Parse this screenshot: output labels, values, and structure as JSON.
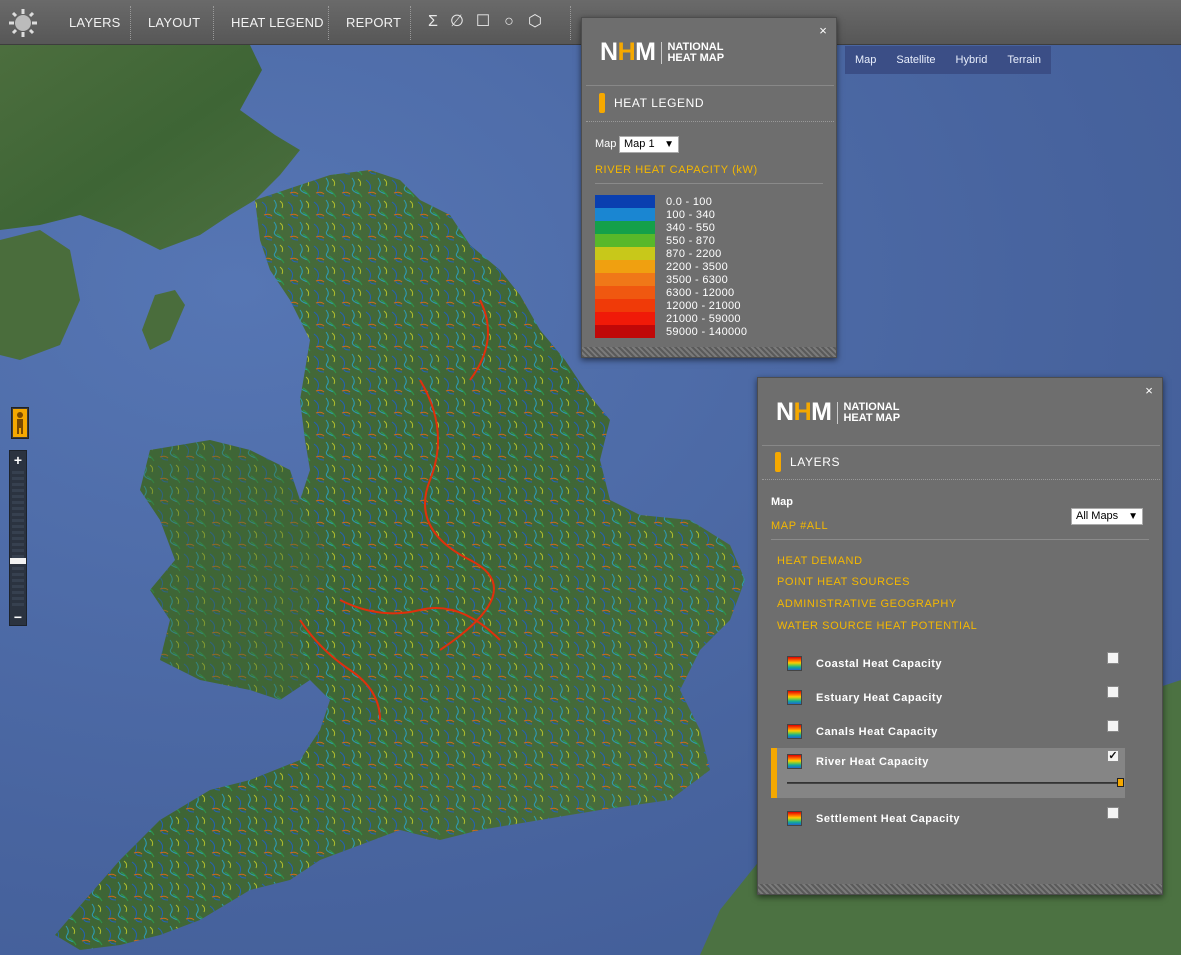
{
  "toolbar": {
    "items": [
      "LAYERS",
      "LAYOUT",
      "HEAT LEGEND",
      "REPORT"
    ],
    "tools": {
      "sum": "Σ",
      "clear": "∅",
      "rectangle": "☐",
      "circle": "○",
      "polygon": "⬡"
    }
  },
  "map_types": [
    "Map",
    "Satellite",
    "Hybrid",
    "Terrain"
  ],
  "zoom": {
    "plus": "+",
    "minus": "−",
    "level": 0.33
  },
  "brand": {
    "mark": {
      "n": "N",
      "h": "H",
      "m": "M"
    },
    "line1": "NATIONAL",
    "line2": "HEAT MAP"
  },
  "legend_panel": {
    "close": "×",
    "title": "HEAT LEGEND",
    "map_label": "Map",
    "map_select": "Map 1",
    "layer_title": "RIVER HEAT CAPACITY (kW)",
    "ranges": [
      {
        "label": "0.0 - 100",
        "color": "#0a3fb0"
      },
      {
        "label": "100 - 340",
        "color": "#1a86d2"
      },
      {
        "label": "340 - 550",
        "color": "#14a04a"
      },
      {
        "label": "550 - 870",
        "color": "#58b82a"
      },
      {
        "label": "870 - 2200",
        "color": "#c8c81a"
      },
      {
        "label": "2200 - 3500",
        "color": "#f0a010"
      },
      {
        "label": "3500 - 6300",
        "color": "#f07818"
      },
      {
        "label": "6300 - 12000",
        "color": "#f05810"
      },
      {
        "label": "12000 - 21000",
        "color": "#f03a08"
      },
      {
        "label": "21000 - 59000",
        "color": "#f01a08"
      },
      {
        "label": "59000 - 140000",
        "color": "#c00808"
      }
    ]
  },
  "layers_panel": {
    "close": "×",
    "title": "LAYERS",
    "map_heading": "Map",
    "map_id": "MAP #ALL",
    "map_select": "All Maps",
    "groups": [
      "HEAT DEMAND",
      "POINT HEAT SOURCES",
      "ADMINISTRATIVE GEOGRAPHY",
      "WATER SOURCE HEAT POTENTIAL"
    ],
    "layers": [
      {
        "name": "Coastal Heat Capacity",
        "checked": false
      },
      {
        "name": "Estuary Heat Capacity",
        "checked": false
      },
      {
        "name": "Canals Heat Capacity",
        "checked": false
      },
      {
        "name": "River Heat Capacity",
        "checked": true,
        "opacity": 1.0
      },
      {
        "name": "Settlement Heat Capacity",
        "checked": false
      }
    ],
    "check_mark": "✓"
  },
  "colors": {
    "accent": "#f5a800",
    "toolbar": "#626262",
    "panel": "#6e6e6e",
    "sea": "#4a6aa8",
    "land": "#3f6a3a"
  }
}
